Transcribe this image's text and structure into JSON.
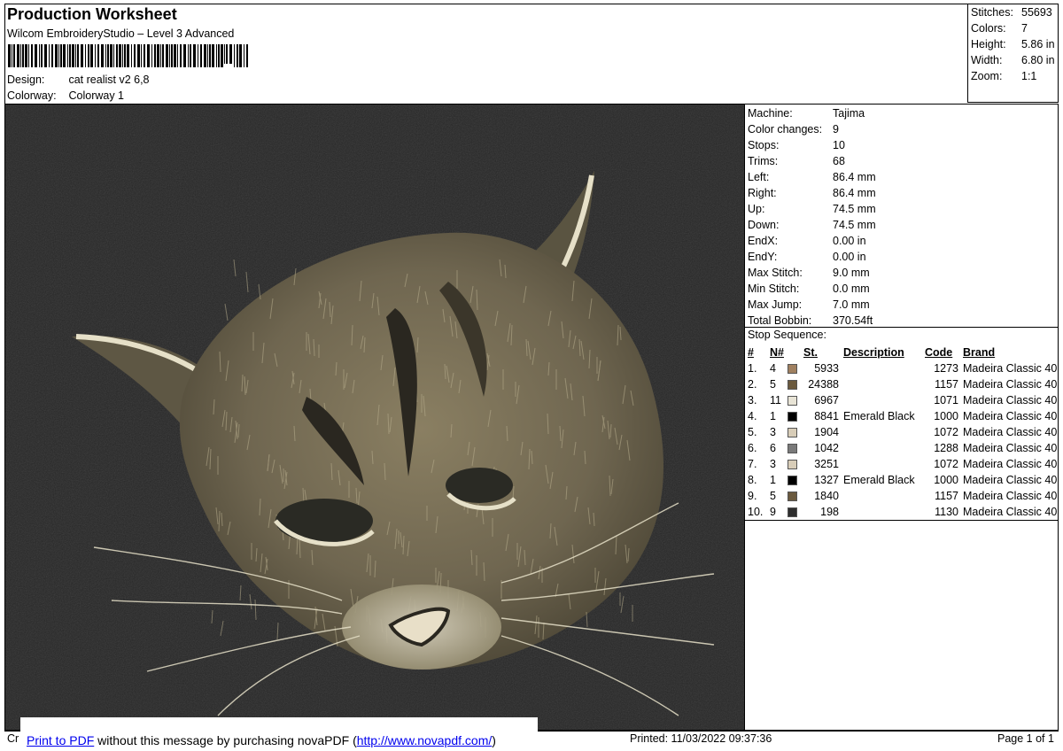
{
  "header": {
    "title": "Production Worksheet",
    "subtitle": "Wilcom EmbroideryStudio – Level 3 Advanced",
    "design_label": "Design:",
    "design_value": "cat realist v2 6,8",
    "colorway_label": "Colorway:",
    "colorway_value": "Colorway 1"
  },
  "summary": [
    {
      "label": "Stitches:",
      "value": "55693"
    },
    {
      "label": "Colors:",
      "value": "7"
    },
    {
      "label": "Height:",
      "value": "5.86 in"
    },
    {
      "label": "Width:",
      "value": "6.80 in"
    },
    {
      "label": "Zoom:",
      "value": "1:1"
    }
  ],
  "details": [
    {
      "label": "Machine:",
      "value": "Tajima"
    },
    {
      "label": "Color changes:",
      "value": "9"
    },
    {
      "label": "Stops:",
      "value": "10"
    },
    {
      "label": "Trims:",
      "value": "68"
    },
    {
      "label": "Left:",
      "value": "86.4 mm"
    },
    {
      "label": "Right:",
      "value": "86.4 mm"
    },
    {
      "label": "Up:",
      "value": "74.5 mm"
    },
    {
      "label": "Down:",
      "value": "74.5 mm"
    },
    {
      "label": "EndX:",
      "value": "0.00 in"
    },
    {
      "label": "EndY:",
      "value": "0.00 in"
    },
    {
      "label": "Max Stitch:",
      "value": "9.0 mm"
    },
    {
      "label": "Min Stitch:",
      "value": "0.0 mm"
    },
    {
      "label": "Max Jump:",
      "value": "7.0 mm"
    },
    {
      "label": "Total Bobbin:",
      "value": "370.54ft"
    }
  ],
  "stops": {
    "title": "Stop Sequence:",
    "headers": {
      "idx": "#",
      "n": "N#",
      "st": "St.",
      "desc": "Description",
      "code": "Code",
      "brand": "Brand"
    },
    "rows": [
      {
        "idx": "1.",
        "n": "4",
        "color": "#a08060",
        "st": "5933",
        "desc": "",
        "code": "1273",
        "brand": "Madeira Classic 40"
      },
      {
        "idx": "2.",
        "n": "5",
        "color": "#6b5a3e",
        "st": "24388",
        "desc": "",
        "code": "1157",
        "brand": "Madeira Classic 40"
      },
      {
        "idx": "3.",
        "n": "11",
        "color": "#e8e4d6",
        "st": "6967",
        "desc": "",
        "code": "1071",
        "brand": "Madeira Classic 40"
      },
      {
        "idx": "4.",
        "n": "1",
        "color": "#000000",
        "st": "8841",
        "desc": "Emerald Black",
        "code": "1000",
        "brand": "Madeira Classic 40"
      },
      {
        "idx": "5.",
        "n": "3",
        "color": "#d8cdb8",
        "st": "1904",
        "desc": "",
        "code": "1072",
        "brand": "Madeira Classic 40"
      },
      {
        "idx": "6.",
        "n": "6",
        "color": "#7a7a7a",
        "st": "1042",
        "desc": "",
        "code": "1288",
        "brand": "Madeira Classic 40"
      },
      {
        "idx": "7.",
        "n": "3",
        "color": "#d8cdb8",
        "st": "3251",
        "desc": "",
        "code": "1072",
        "brand": "Madeira Classic 40"
      },
      {
        "idx": "8.",
        "n": "1",
        "color": "#000000",
        "st": "1327",
        "desc": "Emerald Black",
        "code": "1000",
        "brand": "Madeira Classic 40"
      },
      {
        "idx": "9.",
        "n": "5",
        "color": "#6b5a3e",
        "st": "1840",
        "desc": "",
        "code": "1157",
        "brand": "Madeira Classic 40"
      },
      {
        "idx": "10.",
        "n": "9",
        "color": "#2e2e2e",
        "st": "198",
        "desc": "",
        "code": "1130",
        "brand": "Madeira Classic 40"
      }
    ]
  },
  "footer": {
    "left": "Cr",
    "printed": "Printed: 11/03/2022 09:37:36",
    "page": "Page 1 of 1"
  },
  "banner": {
    "link1": "Print to PDF",
    "middle": " without this message by purchasing novaPDF (",
    "link2": "http://www.novapdf.com/",
    "end": ")"
  },
  "colors": {
    "background_fabric": "#262626",
    "thread_light": "#e8e4d6",
    "thread_tan": "#a08060",
    "thread_brown": "#6b5a3e",
    "link": "#0000ee"
  }
}
